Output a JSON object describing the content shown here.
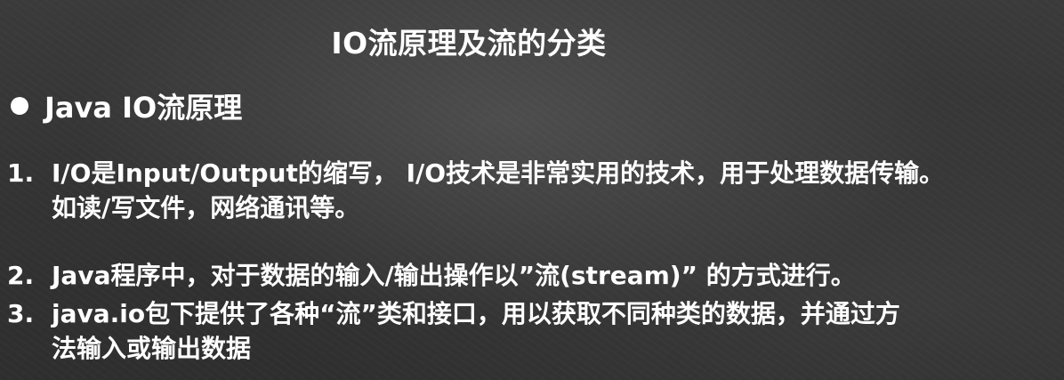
{
  "slide": {
    "title": "IO流原理及流的分类",
    "heading": "Java IO流原理",
    "items": [
      {
        "number": "1.",
        "lines": [
          "I/O是Input/Output的缩写， I/O技术是非常实用的技术，用于处理数据传输。",
          "如读/写文件，网络通讯等。"
        ]
      },
      {
        "number": "2.",
        "lines": [
          "Java程序中，对于数据的输入/输出操作以”流(stream)” 的方式进行。"
        ]
      },
      {
        "number": "3.",
        "lines": [
          "java.io包下提供了各种“流”类和接口，用以获取不同种类的数据，并通过方",
          "法输入或输出数据"
        ]
      }
    ]
  }
}
